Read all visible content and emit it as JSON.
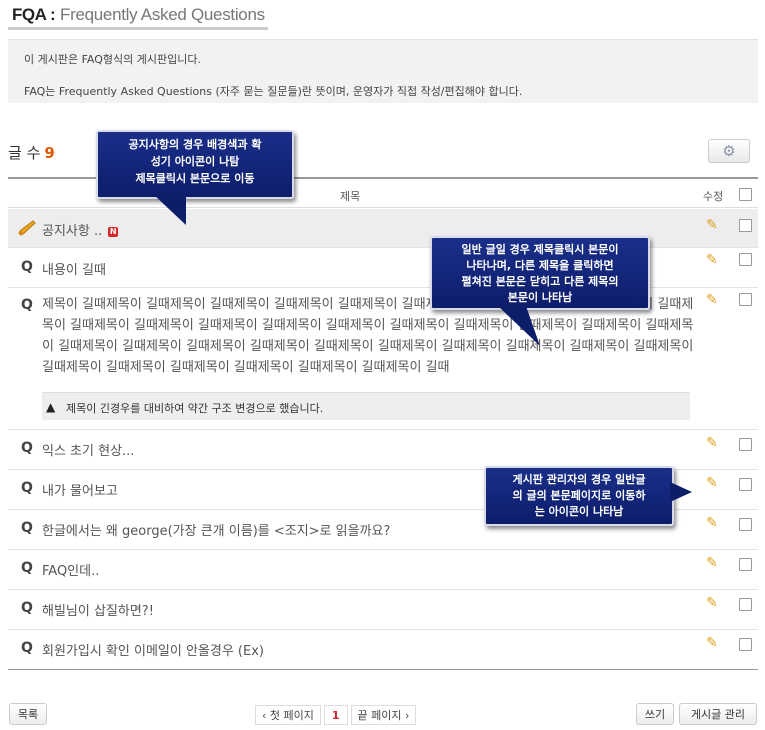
{
  "header": {
    "title_abbr": "FQA :",
    "title_full": "Frequently Asked Questions"
  },
  "info": {
    "line1": "이 게시판은 FAQ형식의 게시판입니다.",
    "line2": "FAQ는 Frequently Asked Questions (자주 묻는 질문들)란 뜻이며, 운영자가 직접 작성/편집해야 합니다."
  },
  "count": {
    "label": "글 수",
    "value": "9"
  },
  "settings_icon": "gear-icon",
  "table": {
    "col_title": "제목",
    "col_edit": "수정",
    "notice": {
      "title": "공지사항 ..",
      "badge": "N",
      "icon": "megaphone-icon"
    },
    "rows": [
      {
        "q": "Q",
        "title": "내용이 길때"
      },
      {
        "q": "Q",
        "title": "제목이 길때제목이 길때제목이 길때제목이 길때제목이 길때제목이 길때제목이 길때제목이 길때제목이 길때제목이 길때제목이 길때제목이 길때제목이 길때제목이 길때제목이 길때제목이 길때제목이 길때제목이 길때제목이 길때제목이 길때제목이 길때제목이 길때제목이 길때제목이 길때제목이 길때제목이 길때제목이 길때제목이 길때제목이 길때제목이 길때제목이 길때제목이 길때제목이 길때제목이 길때제목이 길때제목이 길때제목이 길때"
      },
      {
        "q": "Q",
        "title": "익스 초기 현상..."
      },
      {
        "q": "Q",
        "title": "내가 물어보고"
      },
      {
        "q": "Q",
        "title": "한글에서는 왜 george(가장 큰개 이름)를 <조지>로 읽을까요?"
      },
      {
        "q": "Q",
        "title": "FAQ인데.."
      },
      {
        "q": "Q",
        "title": "해빌님이 삽질하면?!"
      },
      {
        "q": "Q",
        "title": "회원가입시 확인 이메일이 안올경우 (Ex)"
      }
    ],
    "answer": {
      "text": "제목이 긴경우를 대비하여 약간 구조 변경으로 했습니다."
    }
  },
  "footer": {
    "list_button": "목록",
    "pager": {
      "first": "‹ 첫 페이지",
      "current": "1",
      "last": "끝 페이지 ›"
    },
    "write_button": "쓰기",
    "manage_button": "게시글 관리"
  },
  "callouts": {
    "notice": [
      "공지사항의 경우 배경색과 확",
      "성기 아이콘이 나탐",
      "제목클릭시 본문으로 이동"
    ],
    "general": [
      "일반 글일 경우 제목클릭시 본문이",
      "나타나며, 다른 제목을 클릭하면",
      "펼쳐진 본문은 닫히고 다른 제목의",
      "본문이 나타남"
    ],
    "admin": [
      "게시판 관리자의 경우 일반글",
      "의 글의 본문페이지로 이동하",
      "는 아이콘이 나타남"
    ]
  },
  "colors": {
    "count": "#e05a00",
    "callout": "#122580",
    "pencil": "#e0a020",
    "badge": "#d9232d"
  }
}
